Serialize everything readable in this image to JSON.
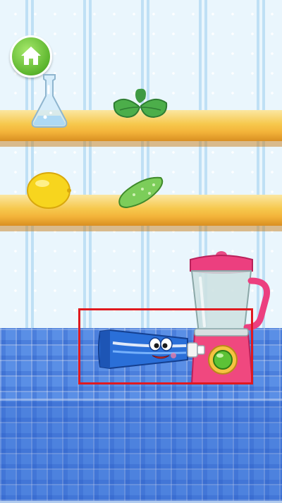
{
  "scene": {
    "home_button_icon": "home-icon",
    "shelf_top_items": [
      "glass-flask",
      "mint-leaves"
    ],
    "shelf_middle_items": [
      "lemon",
      "cucumber"
    ],
    "counter_items": [
      "toothpaste-tube-character",
      "blender"
    ],
    "highlight_color": "#e0191f"
  }
}
